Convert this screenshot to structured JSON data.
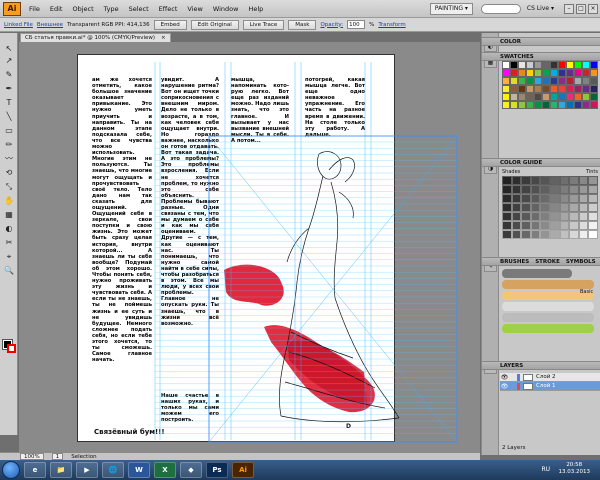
{
  "menubar": {
    "logo": "Ai",
    "items": [
      "File",
      "Edit",
      "Object",
      "Type",
      "Select",
      "Effect",
      "View",
      "Window",
      "Help"
    ],
    "workspace": "PAINTING ▾",
    "cslive": "CS Live ▾",
    "min": "–",
    "max": "□",
    "close": "×"
  },
  "controlbar": {
    "linked_file": "Linked File",
    "file_name": "Внешнее",
    "image_info": "Transparent RGB  PPI: 414,136",
    "embed": "Embed",
    "edit_original": "Edit Original",
    "live_trace": "Live Trace",
    "mask": "Mask",
    "opacity_label": "Opacity:",
    "opacity_value": "100",
    "opacity_unit": "%",
    "transform": "Transform"
  },
  "document_tab": {
    "title": "СБ статья правки.ai* @ 100% (CMYK/Preview)",
    "close": "×"
  },
  "tools": [
    "↖",
    "↗",
    "✎",
    "✒",
    "T",
    "╲",
    "▭",
    "✏",
    "〰",
    "⟲",
    "⤡",
    "✋",
    "▦",
    "◐",
    "✂",
    "⌖",
    "🔍"
  ],
  "artboard": {
    "col1": "ам же хочется отметить, какое большое значение оказывает привыкание. Это нужно уметь приучить и направить. Ты на данном этапе подсказала себе, что все чувства можно использовать. Многие этим не пользуются. Ты знаешь, что многие могут ощущать и прочувствовать своё тело. Тело дано нам так сказать для ощущений. Ощущений себя в зеркале, свои поступки и свою жизнь. Это может быть сразу целая история, внутри которой... А знаешь ли ты себя вообще? Подумай об этом хорошо. Чтобы понять себя, нужно проживать эту жизнь и чувствовать себя. А если ты не знаешь, ты не поймешь жизнь и ее суть и не увидишь будущее. Немного сложнее подать себя, но если тебе этого хочется, то ты сможешь. Самое главное начать.",
    "col2": "увидит. А нарушение ритма? Вот он ищет точки соприкосновения с внешним миром. Дело не только в возрасте, а в том, как человек себя ощущает внутри. Но гораздо важнее, насколько он готов отдавать. Вот такая задача. А это проблемы? Это проблемы взросления. Если не хочется проблем, то нужно это себе объяснить. Проблемы бывают разные. Одни связаны с тем, что мы думаем о себе и как мы себя оцениваем. Другие — с тем, как оценивают нас. Ты понимаешь, что нужно самой найти в себе силы, чтобы разобраться в этом. Все мы люди, у всех свои проблемы. Главное не опускать руки. Ты знаешь, что в жизни всё возможно.",
    "col2b": "Наше счастье в наших руках, и только мы сами можем его построить.",
    "col3": "мышца, напоминать кото-рую легко. Вот еще раз изданий можно. Надо лишь знать, что это главное. И вызывает у нас вызвание внешней мысли. Ты в себе. А потом...",
    "col4": "потогрей, какая мышца легче. Вот еще одно неважное упражнение. Его часть на разное время в движении. На столе только эту работу. А дальше.",
    "footer_title": "Связёвный бум!!!",
    "page_num": "D"
  },
  "panels": {
    "color": "COLOR",
    "swatches": "SWATCHES",
    "color_guide": "COLOR GUIDE",
    "shades": "Shades",
    "tints": "Tints",
    "brushes": "BRUSHES",
    "strokes": "STROKE",
    "symbols": "SYMBOLS",
    "basic": "Basic",
    "layers": "LAYERS",
    "layer_count": "2 Layers"
  },
  "swatch_colors": [
    "#ffffff",
    "#000000",
    "#e6e6e6",
    "#cccccc",
    "#999999",
    "#666666",
    "#333333",
    "#ff0000",
    "#ffff00",
    "#00ff00",
    "#00ffff",
    "#0000ff",
    "#ff00ff",
    "#e11b22",
    "#f58220",
    "#ffd200",
    "#8dc63f",
    "#00a651",
    "#00aeef",
    "#2e3192",
    "#662d91",
    "#ec008c",
    "#c1272d",
    "#f7941d",
    "#fbb040",
    "#d7df23",
    "#39b54a",
    "#009444",
    "#27aae1",
    "#1c75bc",
    "#2b3990",
    "#92278f",
    "#be1e2d",
    "#a7a9ac",
    "#808285",
    "#58595b",
    "#f9ed32",
    "#8b5e3c",
    "#603913",
    "#c49a6c",
    "#a97c50",
    "#754c29",
    "#f15a29",
    "#ef4136",
    "#da1c5c",
    "#9e1f63",
    "#662d91",
    "#262262",
    "#fff200",
    "#c2b59b",
    "#998675",
    "#736357",
    "#534741",
    "#c69c6d",
    "#00a79d",
    "#1b75bb",
    "#ee2a7b",
    "#f26522",
    "#8cc63f",
    "#006838",
    "#fcee21",
    "#d9e021",
    "#8dc63f",
    "#37b34a",
    "#009245",
    "#006837",
    "#22b573",
    "#29abe2",
    "#0071bc",
    "#2e3192",
    "#93278f",
    "#d4145a"
  ],
  "guide_shades": [
    "#2a2a2a",
    "#3a3a3a",
    "#4a4a4a",
    "#5a5a5a",
    "#6a6a6a",
    "#7a7a7a",
    "#8a8a8a",
    "#9a9a9a",
    "#aaaaaa",
    "#bababa"
  ],
  "guide_rows": 7,
  "brushes": [
    "#7a7a7a",
    "#d6a25f",
    "#f2c57a",
    "#dcdcdc",
    "#bcbcbc",
    "#9fd04a"
  ],
  "layers": [
    {
      "name": "Слой 2",
      "color": "#5a7cd6",
      "active": false
    },
    {
      "name": "Слой 1",
      "color": "#e34a4a",
      "active": true
    }
  ],
  "statusbar": {
    "zoom": "100%",
    "page": "1",
    "mode": "Selection"
  },
  "taskbar": {
    "apps": [
      "e",
      "📁",
      "▶",
      "🌐",
      "W",
      "X",
      "◆",
      "Ps",
      "Ai"
    ],
    "lang": "RU",
    "time": "20:58",
    "date": "13.03.2013"
  }
}
